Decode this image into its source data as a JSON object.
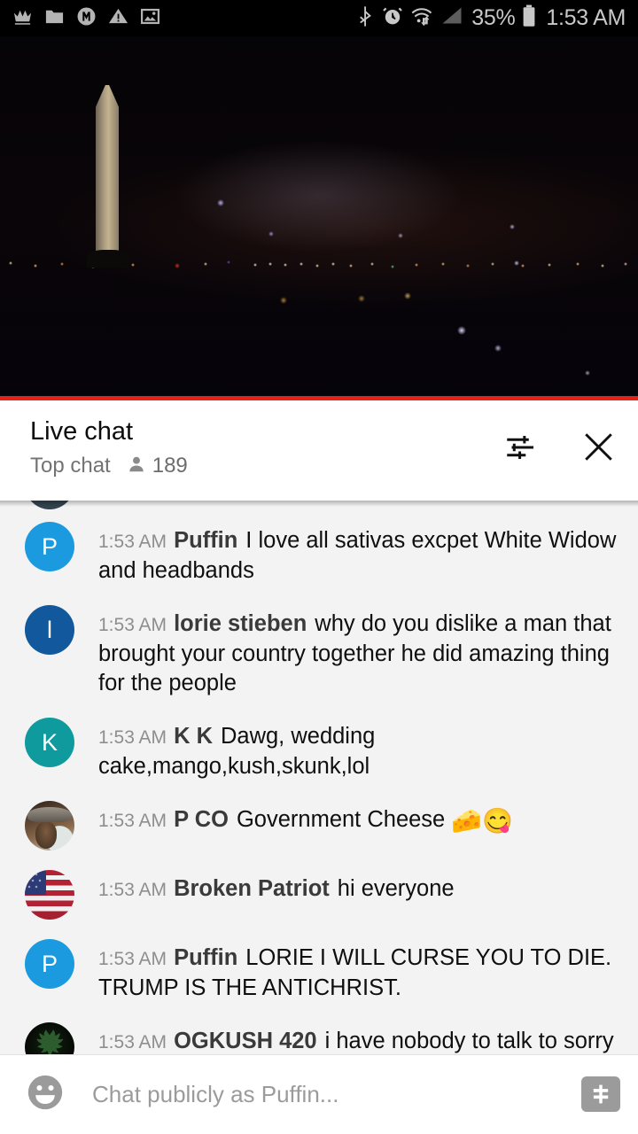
{
  "status_bar": {
    "icons_left": [
      "crown-icon",
      "folder-icon",
      "circled-m-icon",
      "warning-triangle-icon",
      "image-icon"
    ],
    "icons_right": [
      "bluetooth-icon",
      "alarm-clock-icon",
      "wifi-transfer-icon",
      "cellular-signal-icon"
    ],
    "battery_percent": "35%",
    "battery_icon": "battery-icon",
    "clock": "1:53 AM"
  },
  "video": {
    "description": "Night view of Washington DC with the Washington Monument",
    "progress_color": "#e62117",
    "progress_percent": 100
  },
  "chat_header": {
    "title": "Live chat",
    "mode": "Top chat",
    "viewer_icon": "person-icon",
    "viewer_count": "189",
    "tune_button": "tune-icon",
    "close_button": "close-icon"
  },
  "messages": [
    {
      "timestamp": "1:53 AM",
      "author": "Puffin",
      "text": "I love all sativas excpet White Widow and headbands",
      "avatar_type": "initial",
      "avatar_initial": "P",
      "avatar_color": "#1b9ae0"
    },
    {
      "timestamp": "1:53 AM",
      "author": "lorie stieben",
      "text": "why do you dislike a man that brought your country together he did amazing thing for the people",
      "avatar_type": "initial",
      "avatar_initial": "l",
      "avatar_color": "#11589c"
    },
    {
      "timestamp": "1:53 AM",
      "author": "K K",
      "text": "Dawg, wedding cake,mango,kush,skunk,lol",
      "avatar_type": "initial",
      "avatar_initial": "K",
      "avatar_color": "#0f9a9e"
    },
    {
      "timestamp": "1:53 AM",
      "author": "P CO",
      "text": "Government Cheese ",
      "emojis": "🧀😋",
      "avatar_type": "photo-man-with-cap",
      "avatar_initial": "",
      "avatar_color": "#6b4f38"
    },
    {
      "timestamp": "1:53 AM",
      "author": "Broken Patriot",
      "text": "hi everyone",
      "avatar_type": "photo-american-flag",
      "avatar_initial": "",
      "avatar_color": "#b22234"
    },
    {
      "timestamp": "1:53 AM",
      "author": "Puffin",
      "text": "LORIE I WILL CURSE YOU TO DIE. TRUMP IS THE ANTICHRIST.",
      "avatar_type": "initial",
      "avatar_initial": "P",
      "avatar_color": "#1b9ae0"
    },
    {
      "timestamp": "1:53 AM",
      "author": "OGKUSH 420",
      "text": "i have nobody to talk to sorry",
      "avatar_type": "photo-cannabis-leaf",
      "avatar_initial": "",
      "avatar_color": "#12210f"
    }
  ],
  "composer": {
    "emoji_button": "emoji-smiley-icon",
    "input_value": "",
    "placeholder": "Chat publicly as Puffin...",
    "superchat_button": "dollar-sign-icon"
  }
}
